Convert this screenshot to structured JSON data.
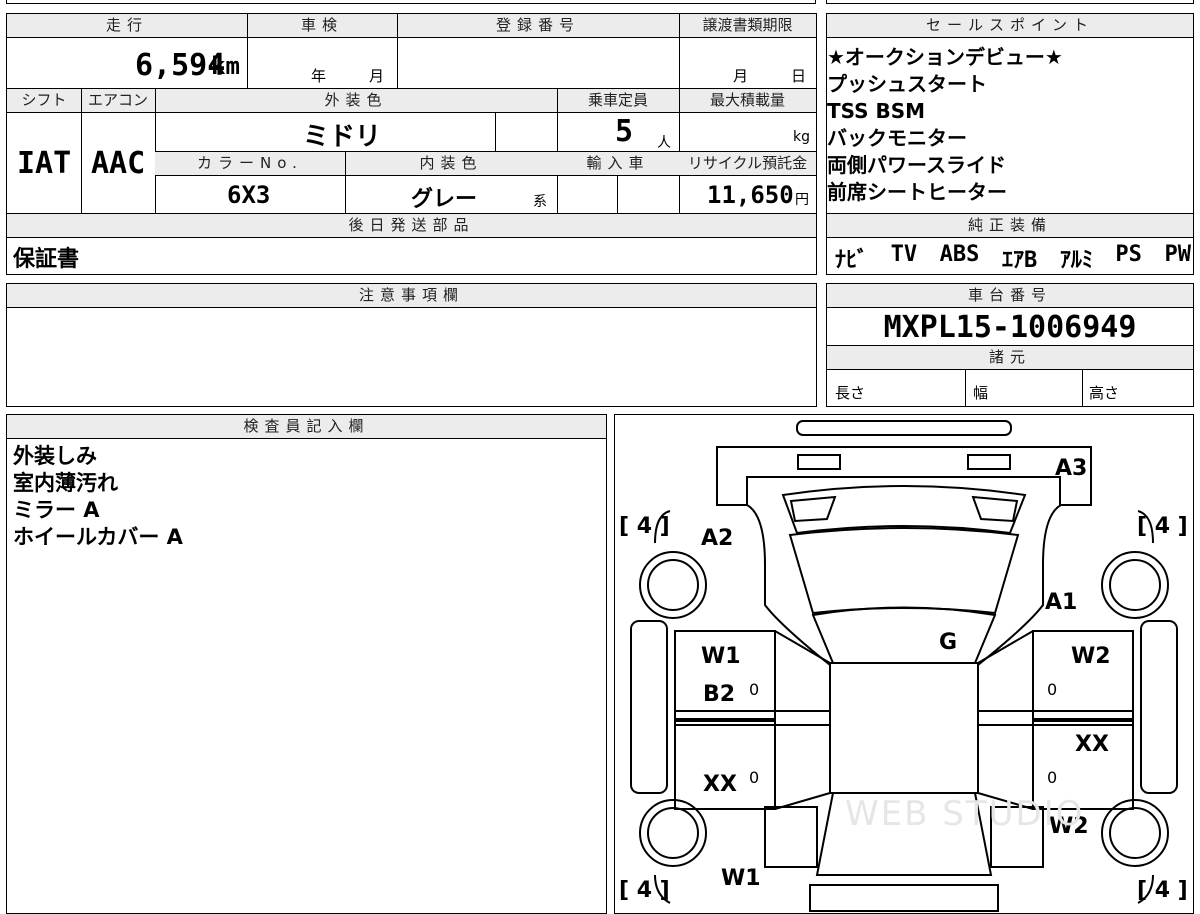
{
  "header": {
    "mileage_label": "走行",
    "shaken_label": "車検",
    "registration_label": "登録番号",
    "transfer_deadline_label": "譲渡書類期限",
    "sales_points_label": "セールスポイント"
  },
  "mileage": {
    "value": "6,594",
    "unit": "km"
  },
  "shaken": {
    "year_unit": "年",
    "month_unit": "月"
  },
  "transfer": {
    "month_unit": "月",
    "day_unit": "日"
  },
  "labels": {
    "shift": "シフト",
    "aircon": "エアコン",
    "exterior_color": "外装色",
    "capacity": "乗車定員",
    "max_load": "最大積載量",
    "color_no": "カラーNo.",
    "interior_color": "内装色",
    "import": "輸入車",
    "recycle": "リサイクル預託金",
    "later_parts": "後日発送部品",
    "notes": "注意事項欄",
    "standard_equipment": "純正装備",
    "chassis_number": "車台番号",
    "specs": "諸元",
    "length": "長さ",
    "width": "幅",
    "height": "高さ",
    "inspector": "検査員記入欄"
  },
  "values": {
    "shift": "IAT",
    "aircon": "AAC",
    "exterior_color": "ミドリ",
    "capacity": "5",
    "capacity_unit": "人",
    "max_load_unit": "kg",
    "color_no": "6X3",
    "interior_color": "グレー",
    "interior_suffix": "系",
    "recycle": "11,650",
    "recycle_unit": "円",
    "later_parts": "保証書",
    "chassis_number": "MXPL15-1006949"
  },
  "sales_points": [
    "★オークションデビュー★",
    "プッシュスタート",
    "TSS BSM",
    "バックモニター",
    "両側パワースライド",
    "前席シートヒーター"
  ],
  "standard_equipment": [
    "ﾅﾋﾞ",
    "TV",
    "ABS",
    "ｴｱB",
    "ｱﾙﾐ",
    "PS",
    "PW"
  ],
  "inspector_notes": [
    "外装しみ",
    "室内薄汚れ",
    "ミラー A",
    "ホイールカバー A"
  ],
  "diagram": {
    "tires": [
      "[ 4 ]",
      "[ 4 ]",
      "[ 4 ]",
      "[ 4 ]"
    ],
    "marks": [
      "A3",
      "A2",
      "A1",
      "G",
      "W1",
      "W2",
      "B2",
      "XX",
      "XX",
      "W2",
      "W1"
    ],
    "zeros": [
      "0",
      "0",
      "0",
      "0"
    ],
    "watermark": "WEB STUDIO"
  }
}
